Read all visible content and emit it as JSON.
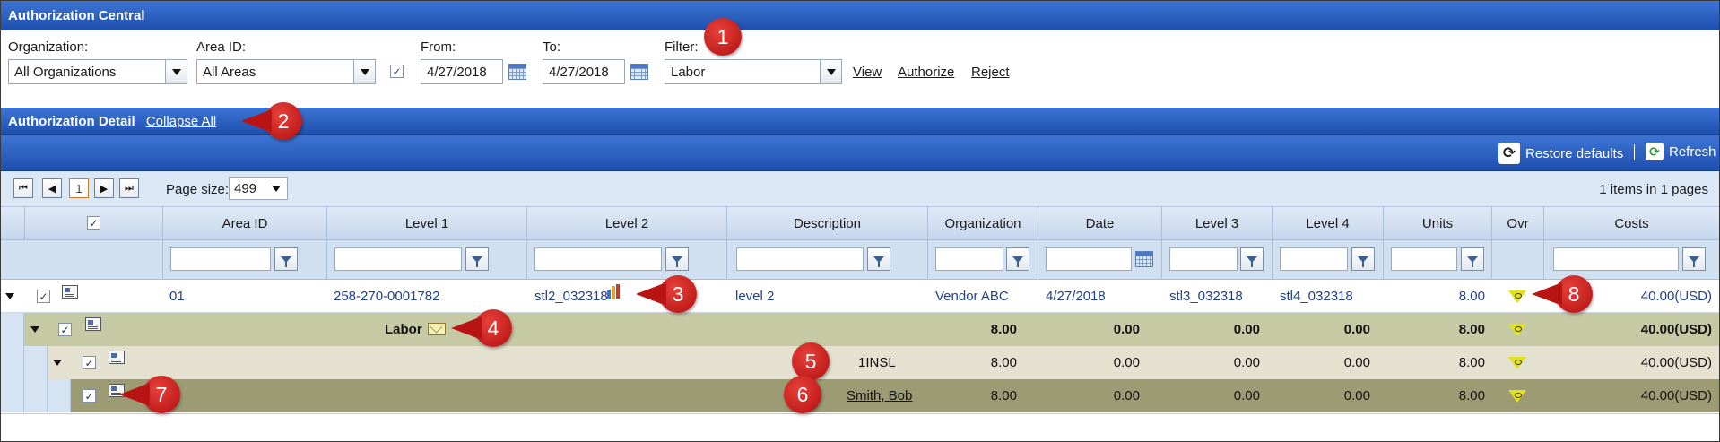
{
  "app": {
    "title": "Authorization Central"
  },
  "filters": {
    "organization_label": "Organization:",
    "organization_value": "All Organizations",
    "area_label": "Area ID:",
    "area_value": "All Areas",
    "include_checkbox": true,
    "from_label": "From:",
    "from_value": "4/27/2018",
    "to_label": "To:",
    "to_value": "4/27/2018",
    "filter_label": "Filter:",
    "filter_value": "Labor",
    "view_link": "View",
    "authorize_link": "Authorize",
    "reject_link": "Reject"
  },
  "detail": {
    "title": "Authorization Detail",
    "collapse_all": "Collapse All",
    "restore_defaults": "Restore defaults",
    "refresh": "Refresh"
  },
  "pager": {
    "current_page": "1",
    "page_size_label": "Page size:",
    "page_size": "499",
    "info": "1 items in 1 pages"
  },
  "columns": [
    "Area ID",
    "Level 1",
    "Level 2",
    "Description",
    "Organization",
    "Date",
    "Level 3",
    "Level 4",
    "Units",
    "Ovr",
    "Costs"
  ],
  "rows": {
    "main": {
      "area_id": "01",
      "level1": "258-270-0001782",
      "level2": "stl2_032318",
      "description": "level 2",
      "organization": "Vendor ABC",
      "date": "4/27/2018",
      "level3": "stl3_032318",
      "level4": "stl4_032318",
      "units": "8.00",
      "costs": "40.00(USD)"
    },
    "group": {
      "label": "Labor",
      "v1": "8.00",
      "v2": "0.00",
      "v3": "0.00",
      "v4": "0.00",
      "units": "8.00",
      "costs": "40.00(USD)"
    },
    "sub": {
      "label": "1INSL",
      "v1": "8.00",
      "v2": "0.00",
      "v3": "0.00",
      "v4": "0.00",
      "units": "8.00",
      "costs": "40.00(USD)"
    },
    "detail": {
      "label": "Smith, Bob",
      "v1": "8.00",
      "v2": "0.00",
      "v3": "0.00",
      "v4": "0.00",
      "units": "8.00",
      "costs": "40.00(USD)"
    }
  },
  "callouts": [
    "1",
    "2",
    "3",
    "4",
    "5",
    "6",
    "7",
    "8"
  ],
  "colors": {
    "header_blue": "#1f4fae",
    "group_row": "#c6caa4",
    "sub_row": "#e5e1d1",
    "detail_row": "#9d9b73",
    "callout_red": "#c41a18"
  }
}
